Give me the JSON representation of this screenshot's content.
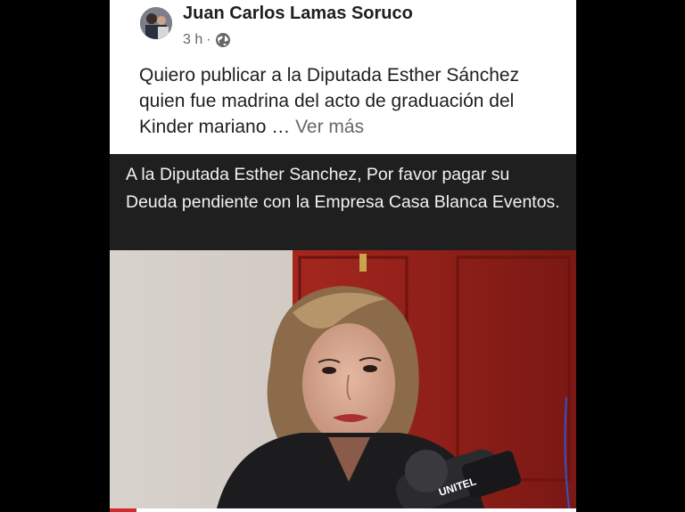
{
  "post": {
    "author": "Juan Carlos Lamas Soruco",
    "time": "3 h",
    "dot": "·",
    "text": "Quiero publicar a la Diputada Esther Sánchez quien fue madrina del acto de graduación del Kinder mariano … ",
    "see_more": "Ver más",
    "caption": "A la Diputada Esther Sanchez,  Por favor pagar su Deuda pendiente con la Empresa Casa Blanca Eventos.",
    "privacy_icon": "globe-icon",
    "microphone_logo": "UNITEL"
  },
  "colors": {
    "text": "#1c1e21",
    "secondary": "#65676b",
    "caption_bg": "#1f1f1f",
    "door": "#8f1d17"
  }
}
